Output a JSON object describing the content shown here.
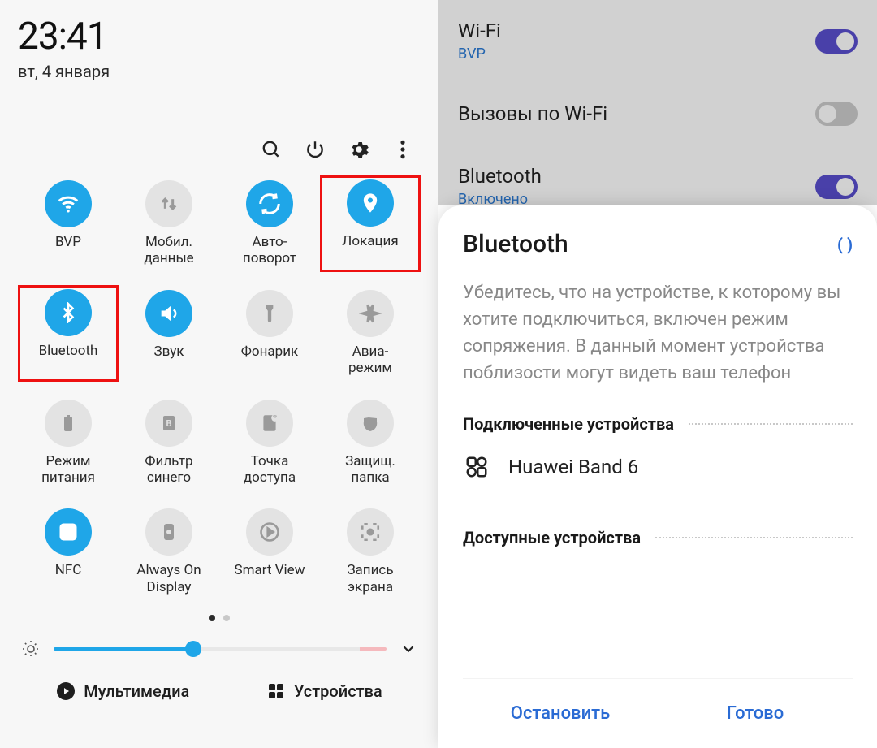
{
  "left": {
    "time": "23:41",
    "date": "вт, 4 января",
    "tiles": [
      {
        "label": "BVP",
        "active": true,
        "icon": "wifi-icon",
        "highlight": false
      },
      {
        "label": "Мобил.\nданные",
        "active": false,
        "icon": "data-icon",
        "highlight": false
      },
      {
        "label": "Авто-\nповорот",
        "active": true,
        "icon": "rotate-icon",
        "highlight": false
      },
      {
        "label": "Локация",
        "active": true,
        "icon": "location-icon",
        "highlight": true
      },
      {
        "label": "Bluetooth",
        "active": true,
        "icon": "bluetooth-icon",
        "highlight": true
      },
      {
        "label": "Звук",
        "active": true,
        "icon": "sound-icon",
        "highlight": false
      },
      {
        "label": "Фонарик",
        "active": false,
        "icon": "flashlight-icon",
        "highlight": false
      },
      {
        "label": "Авиа-\nрежим",
        "active": false,
        "icon": "airplane-icon",
        "highlight": false
      },
      {
        "label": "Режим\nпитания",
        "active": false,
        "icon": "battery-icon",
        "highlight": false
      },
      {
        "label": "Фильтр\nсинего",
        "active": false,
        "icon": "bluelight-icon",
        "highlight": false
      },
      {
        "label": "Точка\nдоступа",
        "active": false,
        "icon": "hotspot-icon",
        "highlight": false
      },
      {
        "label": "Защищ.\nпапка",
        "active": false,
        "icon": "securefolder-icon",
        "highlight": false
      },
      {
        "label": "NFC",
        "active": true,
        "icon": "nfc-icon",
        "highlight": false
      },
      {
        "label": "Always On\nDisplay",
        "active": false,
        "icon": "aod-icon",
        "highlight": false
      },
      {
        "label": "Smart View",
        "active": false,
        "icon": "smartview-icon",
        "highlight": false
      },
      {
        "label": "Запись\nэкрана",
        "active": false,
        "icon": "record-icon",
        "highlight": false
      }
    ],
    "brightness_pct": 42,
    "bottom": {
      "media": "Мультимедиа",
      "devices": "Устройства"
    }
  },
  "right": {
    "wifi": {
      "title": "Wi-Fi",
      "sub": "BVP",
      "on": true
    },
    "wificall": {
      "title": "Вызовы по Wi-Fi",
      "on": false
    },
    "bt": {
      "title": "Bluetooth",
      "sub": "Включено",
      "on": true
    },
    "sheet": {
      "title": "Bluetooth",
      "spinner": "(   )",
      "desc": "Убедитесь, что на устройстве, к которому вы хотите подключиться, включен режим сопряжения. В данный момент устройства поблизости могут видеть ваш телефон",
      "section_paired": "Подключенные устройства",
      "device": "Huawei Band 6",
      "section_available": "Доступные устройства",
      "btn_stop": "Остановить",
      "btn_done": "Готово"
    }
  }
}
